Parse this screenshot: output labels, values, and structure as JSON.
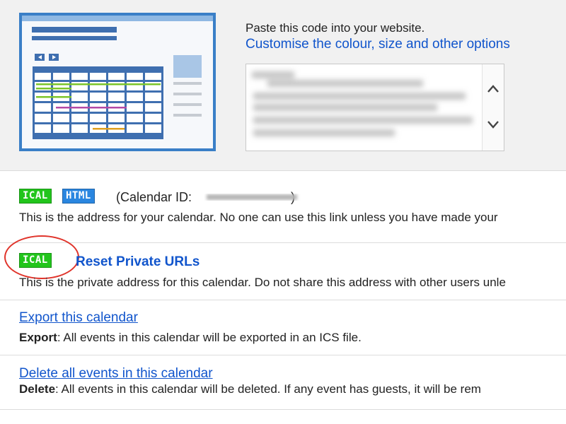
{
  "embed": {
    "instruction": "Paste this code into your website.",
    "customise_link": "Customise the colour, size and other options"
  },
  "public_address": {
    "ical_badge": "ICAL",
    "html_badge": "HTML",
    "calendar_id_prefix": "(Calendar ID:",
    "calendar_id_suffix": ")",
    "description": "This is the address for your calendar. No one can use this link unless you have made your"
  },
  "private_address": {
    "ical_badge": "ICAL",
    "reset_link": "Reset Private URLs",
    "description": "This is the private address for this calendar. Do not share this address with other users unle"
  },
  "export": {
    "link": "Export this calendar",
    "label": "Export",
    "description": ": All events in this calendar will be exported in an ICS file."
  },
  "delete": {
    "link": "Delete all events in this calendar",
    "label": "Delete",
    "description": ": All events in this calendar will be deleted. If any event has guests, it will be rem"
  },
  "colors": {
    "link": "#1155cc",
    "ical_badge": "#22c51c",
    "html_badge": "#2a86e0",
    "highlight_circle": "#e0342b"
  }
}
